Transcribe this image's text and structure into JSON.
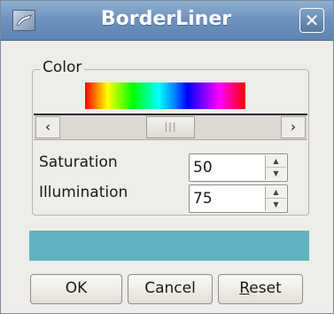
{
  "window": {
    "title": "BorderLiner",
    "close_label": "✕"
  },
  "color_group": {
    "label": "Color",
    "scroll_left": "‹",
    "scroll_right": "›",
    "scroll_thumb_grip": "|||",
    "hue_position": 0.5
  },
  "saturation": {
    "label": "Saturation",
    "value": "50",
    "up": "▲",
    "down": "▼"
  },
  "illumination": {
    "label": "Illumination",
    "value": "75",
    "up": "▲",
    "down": "▼"
  },
  "preview": {
    "color": "#5fb3c0"
  },
  "buttons": {
    "ok": "OK",
    "cancel": "Cancel",
    "reset_mnemonic": "R",
    "reset_rest": "eset"
  }
}
